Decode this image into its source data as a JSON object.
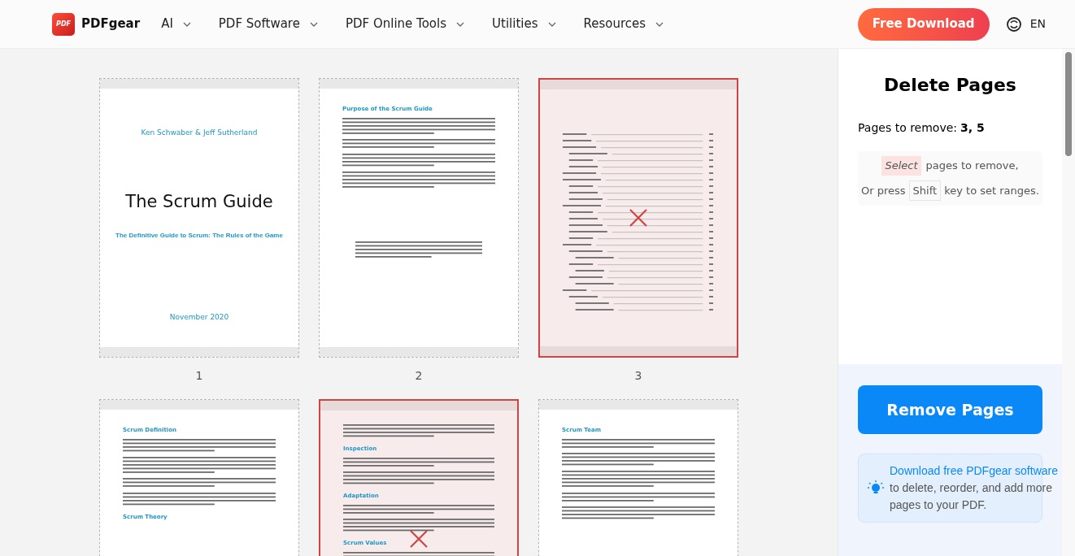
{
  "nav": {
    "brand": "PDFgear",
    "logo_text": "PDF",
    "menu": [
      "AI",
      "PDF Software",
      "PDF Online Tools",
      "Utilities",
      "Resources"
    ],
    "download": "Free Download",
    "language": "EN"
  },
  "pages": [
    {
      "number": "1",
      "selected": false,
      "blocks": [
        {
          "kind": "author",
          "text": "Ken Schwaber & Jeff Sutherland"
        },
        {
          "kind": "title",
          "text": "The Scrum Guide"
        },
        {
          "kind": "subtitle",
          "text": "The Definitive Guide to Scrum: The Rules of the Game"
        },
        {
          "kind": "date",
          "text": "November 2020"
        }
      ]
    },
    {
      "number": "2",
      "selected": false,
      "blocks": [
        {
          "kind": "heading",
          "text": "Purpose of the Scrum Guide"
        },
        {
          "kind": "body"
        },
        {
          "kind": "body"
        },
        {
          "kind": "body"
        },
        {
          "kind": "body"
        },
        {
          "kind": "footer"
        }
      ]
    },
    {
      "number": "3",
      "selected": true,
      "blocks": [
        {
          "kind": "toc"
        }
      ]
    },
    {
      "selected": false,
      "blocks": [
        {
          "kind": "heading",
          "text": "Scrum Definition"
        },
        {
          "kind": "body"
        },
        {
          "kind": "body"
        },
        {
          "kind": "body"
        },
        {
          "kind": "body"
        },
        {
          "kind": "heading",
          "text": "Scrum Theory"
        }
      ]
    },
    {
      "selected": true,
      "blocks": [
        {
          "kind": "body"
        },
        {
          "kind": "heading",
          "text": "Inspection"
        },
        {
          "kind": "body"
        },
        {
          "kind": "body"
        },
        {
          "kind": "heading",
          "text": "Adaptation"
        },
        {
          "kind": "body"
        },
        {
          "kind": "body"
        },
        {
          "kind": "heading",
          "text": "Scrum Values"
        },
        {
          "kind": "body"
        }
      ]
    },
    {
      "selected": false,
      "blocks": [
        {
          "kind": "heading",
          "text": "Scrum Team"
        },
        {
          "kind": "body"
        },
        {
          "kind": "body"
        },
        {
          "kind": "body"
        },
        {
          "kind": "body"
        },
        {
          "kind": "body"
        }
      ]
    }
  ],
  "panel": {
    "title": "Delete Pages",
    "summary_label": "Pages to remove:",
    "summary_value": "3, 5",
    "hint_select": "Select",
    "hint_rest": "pages to remove,",
    "hint_or": "Or press",
    "hint_key": "Shift",
    "hint_end": "key to set ranges.",
    "button": "Remove Pages",
    "promo_link": "Download free PDFgear software",
    "promo_text": "to delete, reorder, and add more pages to your PDF."
  }
}
